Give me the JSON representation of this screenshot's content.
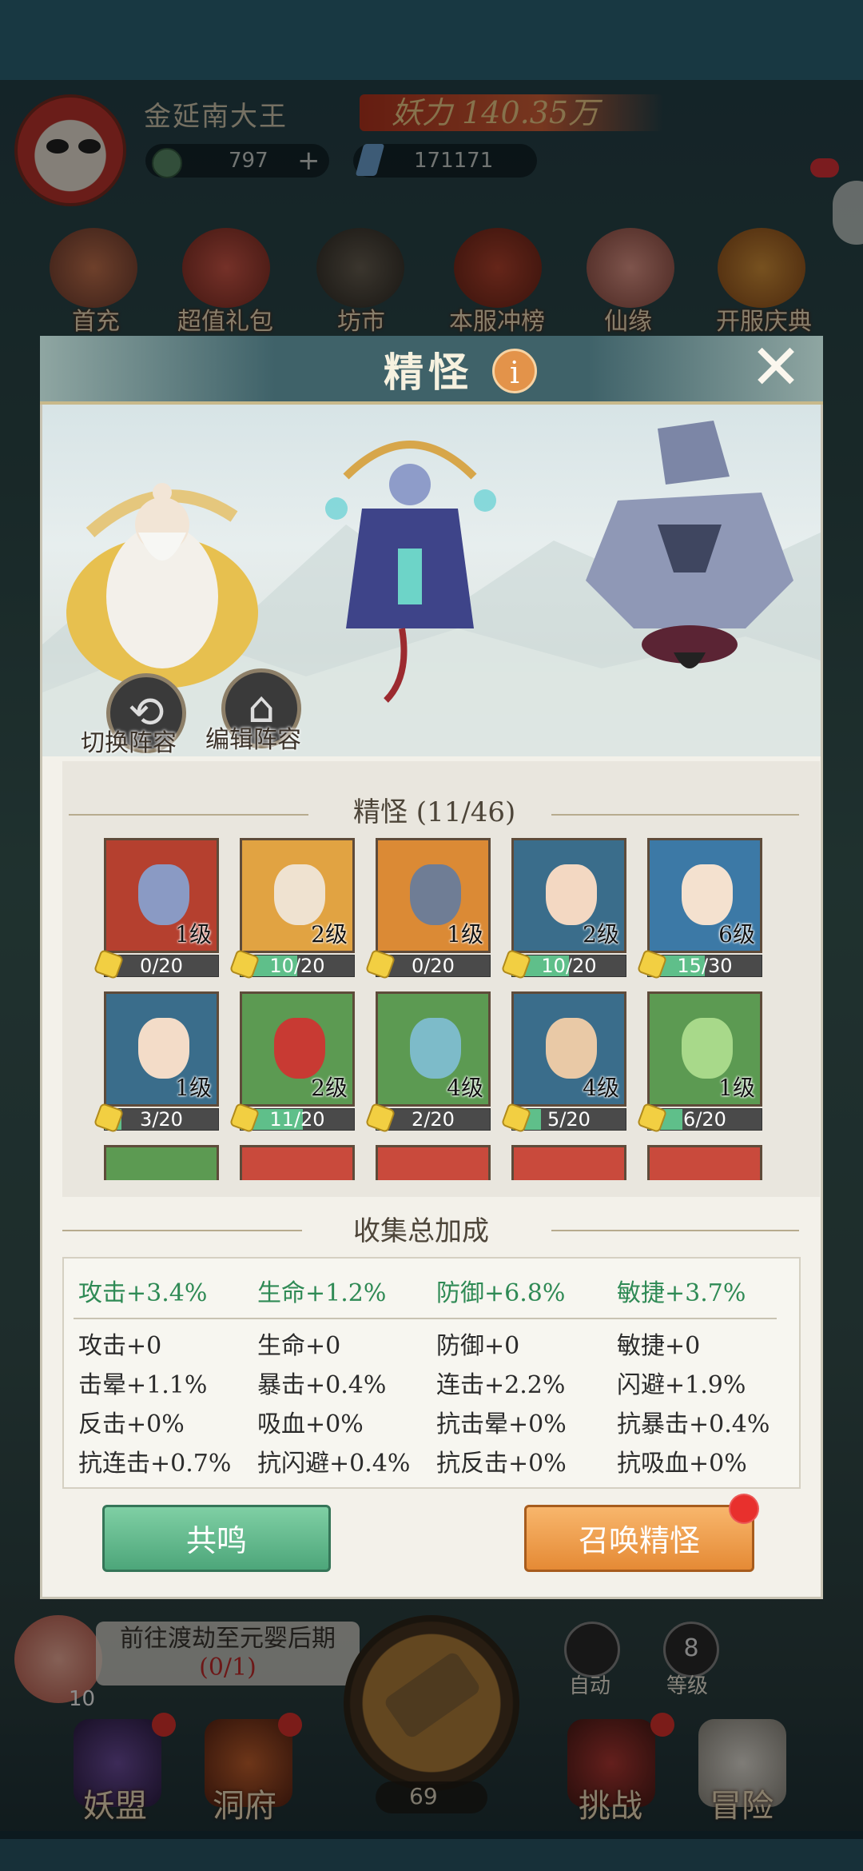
{
  "player": {
    "name": "金延南大王",
    "power_label": "妖力",
    "power_value": "140.35万",
    "currency1": "797",
    "currency1_add": "+",
    "currency2": "171171"
  },
  "top_menu": [
    {
      "label": "首充"
    },
    {
      "label": "超值礼包"
    },
    {
      "label": "坊市"
    },
    {
      "label": "本服冲榜"
    },
    {
      "label": "仙缘"
    },
    {
      "label": "开服庆典"
    }
  ],
  "bottom_bar": {
    "quest_text": "前往渡劫至元婴后期",
    "quest_progress": "(0/1)",
    "quest_count": "10",
    "auto_label": "自动",
    "level_num": "8",
    "level_label": "等级",
    "axe_count": "69",
    "items": [
      {
        "label": "妖盟"
      },
      {
        "label": "洞府"
      },
      {
        "label": "挑战"
      },
      {
        "label": "冒险"
      }
    ]
  },
  "modal": {
    "title": "精怪",
    "info_icon": "i",
    "close_icon": "✕",
    "switch_lineup": "切换阵容",
    "edit_lineup": "编辑阵容",
    "collection_title": "精怪 (11/46)",
    "bonus_title": "收集总加成",
    "resonate_button": "共鸣",
    "summon_button": "召唤精怪"
  },
  "spirits": [
    {
      "level": "1级",
      "progress": "0/20",
      "fill": 0.0,
      "bg": "#b5402f",
      "face": "#8a9ac4"
    },
    {
      "level": "2级",
      "progress": "10/20",
      "fill": 0.5,
      "bg": "#e1a342",
      "face": "#efe2d0"
    },
    {
      "level": "1级",
      "progress": "0/20",
      "fill": 0.0,
      "bg": "#db8a35",
      "face": "#6f7d95"
    },
    {
      "level": "2级",
      "progress": "10/20",
      "fill": 0.5,
      "bg": "#3a6d8b",
      "face": "#f3d8c2"
    },
    {
      "level": "6级",
      "progress": "15/30",
      "fill": 0.5,
      "bg": "#3c79a6",
      "face": "#f4e1cf"
    },
    {
      "level": "1级",
      "progress": "3/20",
      "fill": 0.15,
      "bg": "#3a6d8b",
      "face": "#f3dcc8"
    },
    {
      "level": "2级",
      "progress": "11/20",
      "fill": 0.55,
      "bg": "#5c9a52",
      "face": "#c83a33"
    },
    {
      "level": "4级",
      "progress": "2/20",
      "fill": 0.1,
      "bg": "#5c9a52",
      "face": "#7dbbc9"
    },
    {
      "level": "4级",
      "progress": "5/20",
      "fill": 0.25,
      "bg": "#3a6d8b",
      "face": "#e9c9a6"
    },
    {
      "level": "1级",
      "progress": "6/20",
      "fill": 0.3,
      "bg": "#5c9a52",
      "face": "#a8d98a"
    }
  ],
  "partial_row": [
    {
      "bg": "#5c9a52"
    },
    {
      "bg": "#c94a3c"
    },
    {
      "bg": "#c94a3c"
    },
    {
      "bg": "#c94a3c"
    },
    {
      "bg": "#c94a3c"
    }
  ],
  "bonuses": {
    "highlight": [
      "攻击+3.4%",
      "生命+1.2%",
      "防御+6.8%",
      "敏捷+3.7%"
    ],
    "rows": [
      [
        "攻击+0",
        "生命+0",
        "防御+0",
        "敏捷+0"
      ],
      [
        "击晕+1.1%",
        "暴击+0.4%",
        "连击+2.2%",
        "闪避+1.9%"
      ],
      [
        "反击+0%",
        "吸血+0%",
        "抗击晕+0%",
        "抗暴击+0.4%"
      ],
      [
        "抗连击+0.7%",
        "抗闪避+0.4%",
        "抗反击+0%",
        "抗吸血+0%"
      ]
    ]
  }
}
